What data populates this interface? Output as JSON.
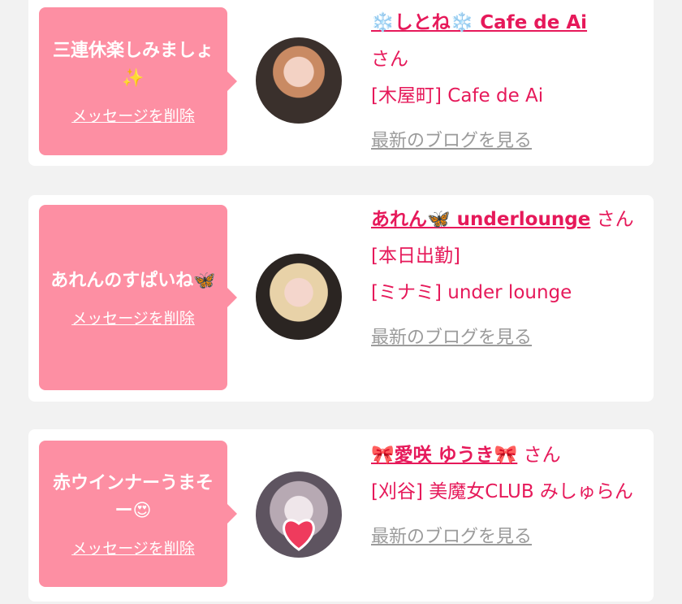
{
  "cards": [
    {
      "message": "三連休楽しみましょ✨",
      "delete_label": "メッセージを削除",
      "name": "❄️しとね❄️ Cafe de Ai",
      "san": "さん",
      "shop": "[木屋町] Cafe de Ai",
      "blog_label": "最新のブログを見る"
    },
    {
      "message": "あれんのすぱいね🦋",
      "delete_label": "メッセージを削除",
      "name": "あれん🦋 underlounge",
      "san": "さん[本日出勤]",
      "shop": "[ミナミ] under lounge",
      "blog_label": "最新のブログを見る"
    },
    {
      "message": "赤ウインナーうまそー😍",
      "delete_label": "メッセージを削除",
      "name": "🎀愛咲 ゆうき🎀",
      "san": "さん",
      "shop": "[刈谷] 美魔女CLUB みしゅらん",
      "blog_label": "最新のブログを見る"
    }
  ],
  "colors": {
    "accent": "#e6195a",
    "bubble": "#fd8fa3",
    "muted": "#9b9b9b"
  }
}
